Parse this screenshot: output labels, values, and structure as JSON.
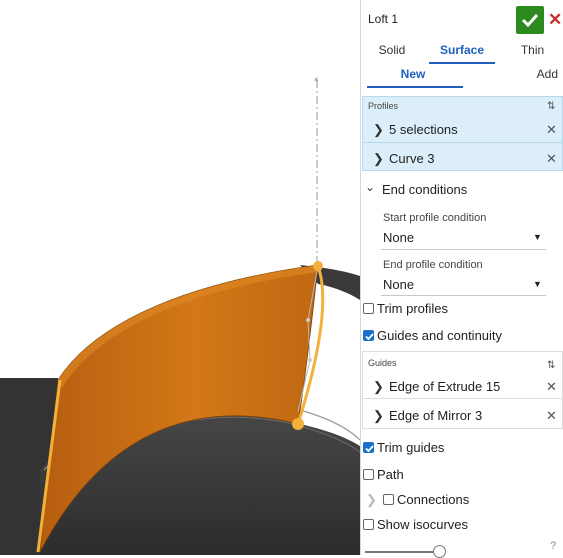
{
  "feature": {
    "title": "Loft 1",
    "ok_icon": "check-icon",
    "cancel_icon": "close-icon",
    "ok_color": "#2c8a1e",
    "cancel_color": "#c8302a"
  },
  "type_tabs": [
    {
      "label": "Solid",
      "active": false
    },
    {
      "label": "Surface",
      "active": true
    },
    {
      "label": "Thin",
      "active": false
    }
  ],
  "op_tabs": [
    {
      "label": "New",
      "active": true
    },
    {
      "label": "Add",
      "active": false
    }
  ],
  "profiles": {
    "header": "Profiles",
    "rows": [
      {
        "label": "5 selections"
      },
      {
        "label": "Curve 3"
      }
    ]
  },
  "end_conditions": {
    "label": "End conditions",
    "start_label": "Start profile condition",
    "start_value": "None",
    "end_label": "End profile condition",
    "end_value": "None"
  },
  "options": {
    "trim_profiles": {
      "label": "Trim profiles",
      "checked": false
    },
    "guides_continuity": {
      "label": "Guides and continuity",
      "checked": true
    }
  },
  "guides": {
    "header": "Guides",
    "rows": [
      {
        "label": "Edge of Extrude 15"
      },
      {
        "label": "Edge of Mirror 3"
      }
    ]
  },
  "options2": {
    "trim_guides": {
      "label": "Trim guides",
      "checked": true
    },
    "path": {
      "label": "Path",
      "checked": false
    },
    "connections": {
      "label": "Connections",
      "checked": false
    },
    "show_isocurves": {
      "label": "Show isocurves",
      "checked": false
    }
  },
  "colors": {
    "accent": "#1f5fbf",
    "surface_orange": "#c76e14",
    "body_dark": "#3a3a3a"
  }
}
